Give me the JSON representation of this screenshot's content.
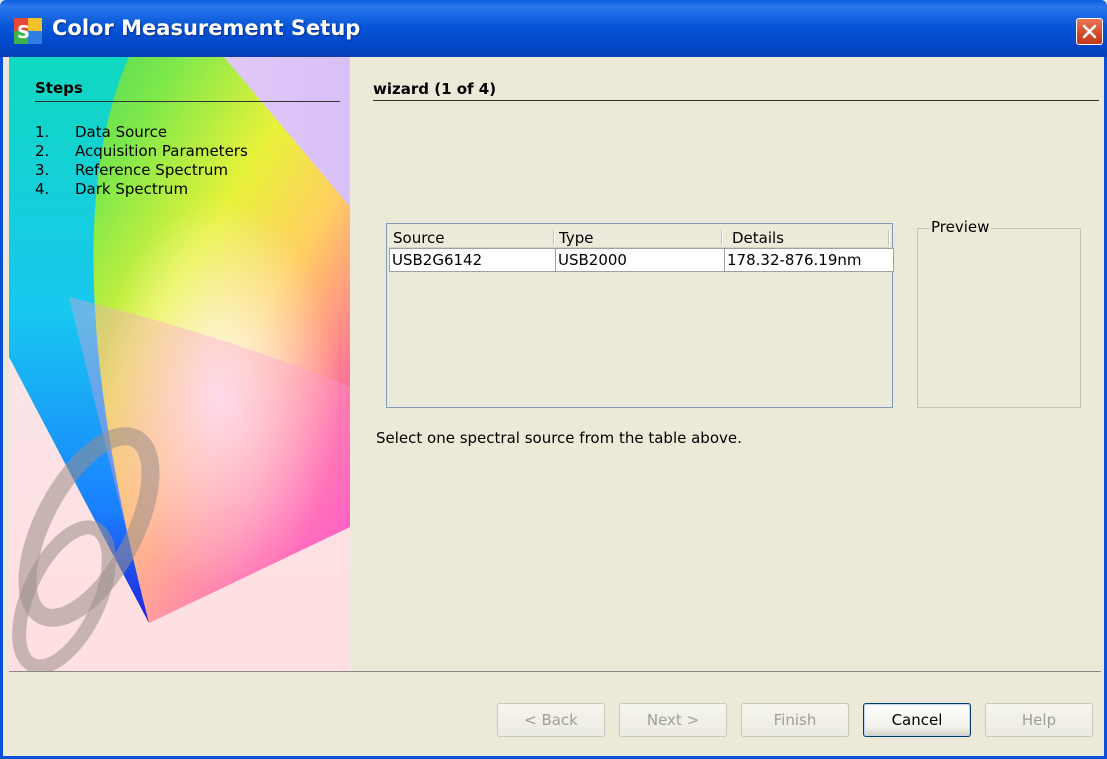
{
  "window": {
    "title": "Color Measurement Setup",
    "app_icon": "spectrasuite-icon"
  },
  "steps": {
    "title": "Steps",
    "items": [
      {
        "num": "1.",
        "label": "Data Source"
      },
      {
        "num": "2.",
        "label": "Acquisition Parameters"
      },
      {
        "num": "3.",
        "label": "Reference Spectrum"
      },
      {
        "num": "4.",
        "label": "Dark Spectrum"
      }
    ]
  },
  "wizard": {
    "title": "wizard (1 of 4)",
    "table": {
      "columns": [
        "Source",
        "Type",
        "Details"
      ],
      "rows": [
        {
          "source": "USB2G6142",
          "type": "USB2000",
          "details": "178.32-876.19nm"
        }
      ]
    },
    "preview_label": "Preview",
    "instruction": "Select one spectral source from the table above."
  },
  "buttons": {
    "back": "< Back",
    "next": "Next >",
    "finish": "Finish",
    "cancel": "Cancel",
    "help": "Help"
  },
  "colors": {
    "titlebar": "#0756d8",
    "window_bg": "#ece9d8",
    "close_button": "#d2482a"
  }
}
